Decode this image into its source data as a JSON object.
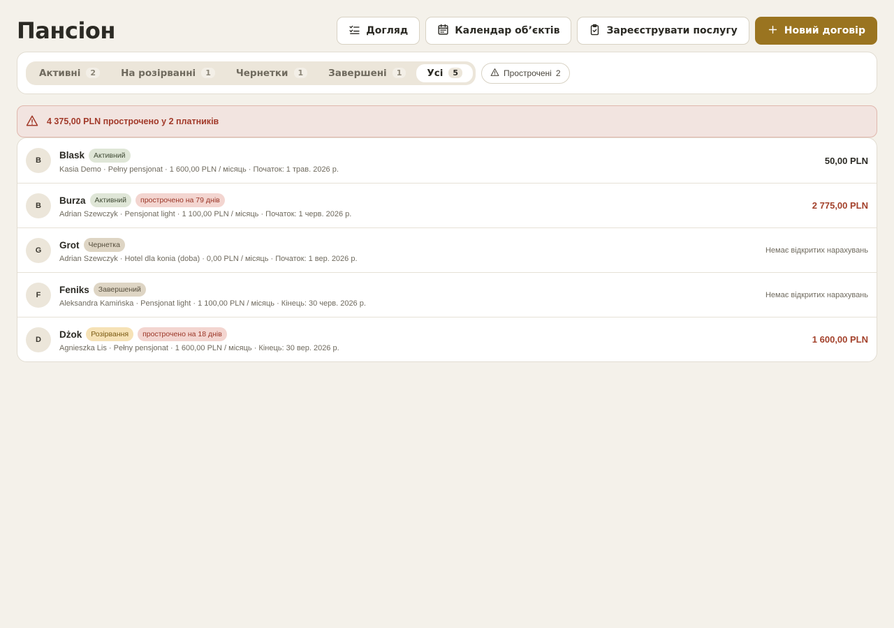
{
  "page": {
    "title": "Пансіон"
  },
  "actions": {
    "care": "Догляд",
    "calendar": "Календар об’єктів",
    "register": "Зареєструвати послугу",
    "new_contract": "Новий договір"
  },
  "tabs": [
    {
      "label": "Активні",
      "count": "2",
      "active": false
    },
    {
      "label": "На розірванні",
      "count": "1",
      "active": false
    },
    {
      "label": "Чернетки",
      "count": "1",
      "active": false
    },
    {
      "label": "Завершені",
      "count": "1",
      "active": false
    },
    {
      "label": "Усі",
      "count": "5",
      "active": true
    }
  ],
  "overdue_filter": {
    "label": "Прострочені",
    "count": "2"
  },
  "alert": {
    "text": "4 375,00 PLN прострочено у 2 платників"
  },
  "rows": [
    {
      "initial": "B",
      "name": "Blask",
      "status": "Активний",
      "overdue": "",
      "details": "Kasia Demo · Pełny pensjonat · 1 600,00 PLN / місяць · Початок: 1 трав. 2026 р.",
      "amount": "50,00 PLN"
    },
    {
      "initial": "B",
      "name": "Burza",
      "status": "Активний",
      "overdue": "прострочено на 79 днів",
      "details": "Adrian Szewczyk · Pensjonat light · 1 100,00 PLN / місяць · Початок: 1 черв. 2026 р.",
      "amount": "2 775,00 PLN"
    },
    {
      "initial": "G",
      "name": "Grot",
      "status": "Чернетка",
      "overdue": "",
      "details": "Adrian Szewczyk · Hotel dla konia (doba) · 0,00 PLN / місяць · Початок: 1 вер. 2026 р.",
      "amount": "Немає відкритих нарахувань"
    },
    {
      "initial": "F",
      "name": "Feniks",
      "status": "Завершений",
      "overdue": "",
      "details": "Aleksandra Kamińska · Pensjonat light · 1 100,00 PLN / місяць · Кінець: 30 черв. 2026 р.",
      "amount": "Немає відкритих нарахувань"
    },
    {
      "initial": "D",
      "name": "Dżok",
      "status": "Розірвання",
      "overdue": "прострочено на 18 днів",
      "details": "Agnieszka Lis · Pełny pensjonat · 1 600,00 PLN / місяць · Кінець: 30 вер. 2026 р.",
      "amount": "1 600,00 PLN"
    }
  ],
  "colors": {
    "background": "#f4f1ea",
    "primary": "#9a7420",
    "danger": "#a3412b",
    "alert_bg": "#f2e4e0"
  }
}
